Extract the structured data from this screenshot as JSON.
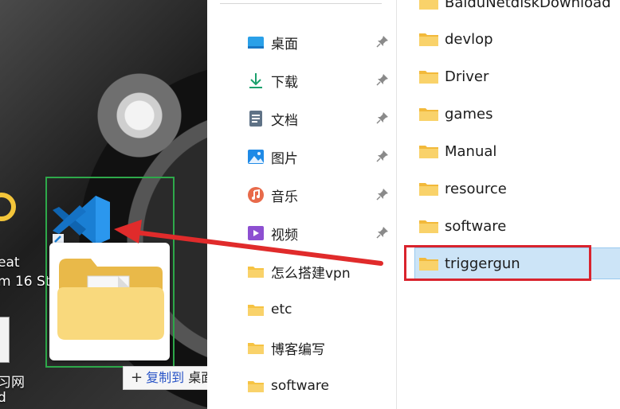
{
  "desktop": {
    "fragment_1": "eat",
    "fragment_2": "m 16 St",
    "fragment_3": "习网",
    "fragment_4": "d",
    "dragged_item": {
      "icon": "vscode-icon",
      "preview_icon": "folder-with-file-icon"
    },
    "copy_tooltip": {
      "plus": "+",
      "verb": "复制到",
      "target": "桌面"
    }
  },
  "nav_pane": {
    "items": [
      {
        "label": "桌面",
        "icon": "desktop-icon",
        "pinned": true
      },
      {
        "label": "下载",
        "icon": "download-icon",
        "pinned": true
      },
      {
        "label": "文档",
        "icon": "document-icon",
        "pinned": true
      },
      {
        "label": "图片",
        "icon": "pictures-icon",
        "pinned": true
      },
      {
        "label": "音乐",
        "icon": "music-icon",
        "pinned": true
      },
      {
        "label": "视频",
        "icon": "video-icon",
        "pinned": true
      },
      {
        "label": "怎么搭建vpn",
        "icon": "folder-icon",
        "pinned": false
      },
      {
        "label": "etc",
        "icon": "folder-icon",
        "pinned": false
      },
      {
        "label": "博客编写",
        "icon": "folder-icon",
        "pinned": false
      },
      {
        "label": "software",
        "icon": "folder-icon",
        "pinned": false
      }
    ]
  },
  "content": {
    "items": [
      {
        "label": "BaiduNetdiskDownload"
      },
      {
        "label": "devlop"
      },
      {
        "label": "Driver"
      },
      {
        "label": "games"
      },
      {
        "label": "Manual"
      },
      {
        "label": "resource"
      },
      {
        "label": "software"
      },
      {
        "label": "triggergun",
        "selected": true
      }
    ]
  },
  "colors": {
    "highlight_box": "#2ea94a",
    "callout_box": "#d9232d",
    "arrow": "#e02b2b",
    "selection": "#cce4f7",
    "folder": "#f6c343"
  }
}
